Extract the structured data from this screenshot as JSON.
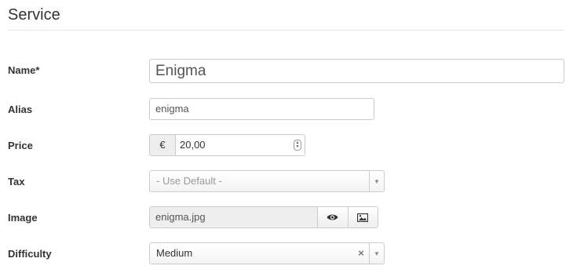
{
  "section": {
    "title": "Service"
  },
  "form": {
    "name": {
      "label": "Name*",
      "value": "Enigma"
    },
    "alias": {
      "label": "Alias",
      "value": "enigma"
    },
    "price": {
      "label": "Price",
      "currency": "€",
      "value": "20,00"
    },
    "tax": {
      "label": "Tax",
      "selected": "- Use Default -"
    },
    "image": {
      "label": "Image",
      "value": "enigma.jpg",
      "preview_icon": "eye-icon",
      "select_icon": "image-icon"
    },
    "difficulty": {
      "label": "Difficulty",
      "selected": "Medium",
      "clear_symbol": "×"
    }
  }
}
